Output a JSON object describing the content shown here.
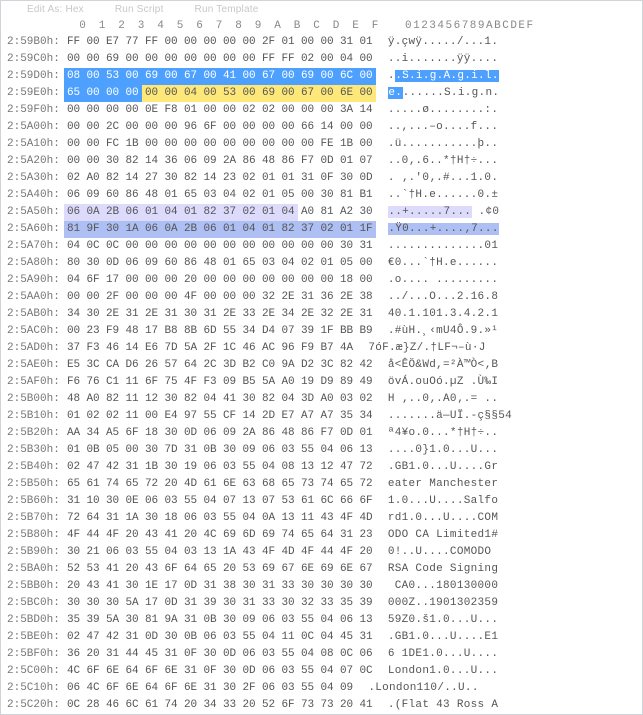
{
  "toolbar": {
    "item1": "Edit As: Hex",
    "item2": "Run Script",
    "item3": "Run Template"
  },
  "header": {
    "groups": [
      "0",
      "1",
      "2",
      "3",
      "4",
      "5",
      "6",
      "7",
      "8",
      "9",
      "A",
      "B",
      "C",
      "D",
      "E",
      "F"
    ],
    "ascii": "0123456789ABCDEF"
  },
  "rows": [
    {
      "addr": "2:59B0h:",
      "hex": [
        {
          "t": "FF 00 E7 77 FF 00 00 00 00 00 2F 01 00 00 31 01",
          "c": ""
        }
      ],
      "asc": [
        {
          "t": "ÿ.çwÿ...../...1.",
          "c": ""
        }
      ]
    },
    {
      "addr": "2:59C0h:",
      "hex": [
        {
          "t": "00 00 69 00 00 00 00 00 00 00 FF FF 02 00 04 00",
          "c": ""
        }
      ],
      "asc": [
        {
          "t": "..i.......ÿÿ....",
          "c": ""
        }
      ]
    },
    {
      "addr": "2:59D0h:",
      "hex": [
        {
          "t": "08 00 53 00 69 00 67 00 41 00 67 00 69 00 6C 00",
          "c": "hl-blue"
        }
      ],
      "asc": [
        {
          "t": ".",
          "c": ""
        },
        {
          "t": ".S.i.g.A.g.i.l.",
          "c": "hl-blue-asc"
        }
      ]
    },
    {
      "addr": "2:59E0h:",
      "hex": [
        {
          "t": "65 00 00 00 ",
          "c": "hl-blue"
        },
        {
          "t": "00 00 04 00 53 00 69 00 67 00 6E 00",
          "c": "hl-yellow"
        }
      ],
      "asc": [
        {
          "t": "e.",
          "c": "hl-blue-asc"
        },
        {
          "t": "......S.i.g.n.",
          "c": ""
        }
      ]
    },
    {
      "addr": "2:59F0h:",
      "hex": [
        {
          "t": "00 00 00 00 0E F8 01 00 00 02 02 00 00 00 3A 14",
          "c": ""
        }
      ],
      "asc": [
        {
          "t": ".....ø........:.",
          "c": ""
        }
      ]
    },
    {
      "addr": "2:5A00h:",
      "hex": [
        {
          "t": "00 00 2C 00 00 00 96 6F 00 00 00 00 66 14 00 00",
          "c": ""
        }
      ],
      "asc": [
        {
          "t": "..,...–o....f...",
          "c": ""
        }
      ]
    },
    {
      "addr": "2:5A10h:",
      "hex": [
        {
          "t": "00 00 FC 1B 00 00 00 00 00 00 00 00 00 FE 1B 00",
          "c": ""
        }
      ],
      "asc": [
        {
          "t": ".ü...........þ..",
          "c": ""
        }
      ]
    },
    {
      "addr": "2:5A20h:",
      "hex": [
        {
          "t": "00 00 30 82 14 36 06 09 2A 86 48 86 F7 0D 01 07",
          "c": ""
        }
      ],
      "asc": [
        {
          "t": "..0‚.6..*†H†÷...",
          "c": ""
        }
      ]
    },
    {
      "addr": "2:5A30h:",
      "hex": [
        {
          "t": "02 A0 82 14 27 30 82 14 23 02 01 01 31 0F 30 0D",
          "c": ""
        }
      ],
      "asc": [
        {
          "t": ". ‚.'0‚.#...1.0.",
          "c": ""
        }
      ]
    },
    {
      "addr": "2:5A40h:",
      "hex": [
        {
          "t": "06 09 60 86 48 01 65 03 04 02 01 05 00 30 81 B1",
          "c": ""
        }
      ],
      "asc": [
        {
          "t": "..`†H.e......0.±",
          "c": ""
        }
      ]
    },
    {
      "addr": "2:5A50h:",
      "hex": [
        {
          "t": "06 0A 2B 06 01 04 01 82 37 02 01 04 ",
          "c": "hl-lav"
        },
        {
          "t": "A0 81 A2 30",
          "c": ""
        }
      ],
      "asc": [
        {
          "t": "..+.....7...",
          "c": "hl-lav-asc"
        },
        {
          "t": " .¢0",
          "c": ""
        }
      ]
    },
    {
      "addr": "2:5A60h:",
      "hex": [
        {
          "t": "81 9F 30 1A 06 0A 2B 06 01 04 01 82 37 02 01 1F",
          "c": "hl-blue2"
        }
      ],
      "asc": [
        {
          "t": ".Ÿ0...+....‚7...",
          "c": "hl-blue2-asc"
        }
      ]
    },
    {
      "addr": "2:5A70h:",
      "hex": [
        {
          "t": "04 0C 0C 00 00 00 00 00 00 00 00 00 00 00 30 31",
          "c": ""
        }
      ],
      "asc": [
        {
          "t": "..............01",
          "c": ""
        }
      ]
    },
    {
      "addr": "2:5A80h:",
      "hex": [
        {
          "t": "80 30 0D 06 09 60 86 48 01 65 03 04 02 01 05 00",
          "c": ""
        }
      ],
      "asc": [
        {
          "t": "€0...`†H.e......",
          "c": ""
        }
      ]
    },
    {
      "addr": "2:5A90h:",
      "hex": [
        {
          "t": "04 6F 17 00 00 00 20 00 00 00 00 00 00 00 18 00",
          "c": ""
        }
      ],
      "asc": [
        {
          "t": ".o.... .........",
          "c": ""
        }
      ]
    },
    {
      "addr": "2:5AA0h:",
      "hex": [
        {
          "t": "00 00 2F 00 00 00 4F 00 00 00 32 2E 31 36 2E 38",
          "c": ""
        }
      ],
      "asc": [
        {
          "t": "../...O...2.16.8",
          "c": ""
        }
      ]
    },
    {
      "addr": "2:5AB0h:",
      "hex": [
        {
          "t": "34 30 2E 31 2E 31 30 31 2E 33 2E 34 2E 32 2E 31",
          "c": ""
        }
      ],
      "asc": [
        {
          "t": "40.1.101.3.4.2.1",
          "c": ""
        }
      ]
    },
    {
      "addr": "2:5AC0h:",
      "hex": [
        {
          "t": "00 23 F9 48 17 B8 8B 6D 55 34 D4 07 39 1F BB B9",
          "c": ""
        }
      ],
      "asc": [
        {
          "t": ".#ùH.¸‹mU4Ô.9.»¹",
          "c": ""
        }
      ]
    },
    {
      "addr": "2:5AD0h:",
      "hex": [
        {
          "t": "37 F3 46 14 E6 7D 5A 2F 1C 46 AC 96 F9 B7 4A",
          "c": ""
        }
      ],
      "asc": [
        {
          "t": "7óF.æ}Z/.†LF¬–ù·J",
          "c": ""
        }
      ]
    },
    {
      "addr": "2:5AE0h:",
      "hex": [
        {
          "t": "E5 3C CA D6 26 57 64 2C 3D B2 C0 9A D2 3C 82 42",
          "c": ""
        }
      ],
      "asc": [
        {
          "t": "å<ÊÖ&Wd,=²À™Ò<‚B",
          "c": ""
        }
      ]
    },
    {
      "addr": "2:5AF0h:",
      "hex": [
        {
          "t": "F6 76 C1 11 6F 75 4F F3 09 B5 5A A0 19 D9 89 49",
          "c": ""
        }
      ],
      "asc": [
        {
          "t": "övÁ.ouOó.µZ .Ù‰I",
          "c": ""
        }
      ]
    },
    {
      "addr": "2:5B00h:",
      "hex": [
        {
          "t": "48 A0 82 11 12 30 82 04 41 30 82 04 3D A0 03 02",
          "c": ""
        }
      ],
      "asc": [
        {
          "t": "H ‚..0‚.A0‚.= ..",
          "c": ""
        }
      ]
    },
    {
      "addr": "2:5B10h:",
      "hex": [
        {
          "t": "01 02 02 11 00 E4 97 55 CF 14 2D E7 A7 A7 35 34",
          "c": ""
        }
      ],
      "asc": [
        {
          "t": ".......ä—UÏ.-ç§§54",
          "c": ""
        }
      ]
    },
    {
      "addr": "2:5B20h:",
      "hex": [
        {
          "t": "AA 34 A5 6F 18 30 0D 06 09 2A 86 48 86 F7 0D 01",
          "c": ""
        }
      ],
      "asc": [
        {
          "t": "ª4¥o.0...*†H†÷..",
          "c": ""
        }
      ]
    },
    {
      "addr": "2:5B30h:",
      "hex": [
        {
          "t": "01 0B 05 00 30 7D 31 0B 30 09 06 03 55 04 06 13",
          "c": ""
        }
      ],
      "asc": [
        {
          "t": "....0}1.0...U...",
          "c": ""
        }
      ]
    },
    {
      "addr": "2:5B40h:",
      "hex": [
        {
          "t": "02 47 42 31 1B 30 19 06 03 55 04 08 13 12 47 72",
          "c": ""
        }
      ],
      "asc": [
        {
          "t": ".GB1.0...U....Gr",
          "c": ""
        }
      ]
    },
    {
      "addr": "2:5B50h:",
      "hex": [
        {
          "t": "65 61 74 65 72 20 4D 61 6E 63 68 65 73 74 65 72",
          "c": ""
        }
      ],
      "asc": [
        {
          "t": "eater Manchester",
          "c": ""
        }
      ]
    },
    {
      "addr": "2:5B60h:",
      "hex": [
        {
          "t": "31 10 30 0E 06 03 55 04 07 13 07 53 61 6C 66 6F",
          "c": ""
        }
      ],
      "asc": [
        {
          "t": "1.0...U....Salfo",
          "c": ""
        }
      ]
    },
    {
      "addr": "2:5B70h:",
      "hex": [
        {
          "t": "72 64 31 1A 30 18 06 03 55 04 0A 13 11 43 4F 4D",
          "c": ""
        }
      ],
      "asc": [
        {
          "t": "rd1.0...U....COM",
          "c": ""
        }
      ]
    },
    {
      "addr": "2:5B80h:",
      "hex": [
        {
          "t": "4F 44 4F 20 43 41 20 4C 69 6D 69 74 65 64 31 23",
          "c": ""
        }
      ],
      "asc": [
        {
          "t": "ODO CA Limited1#",
          "c": ""
        }
      ]
    },
    {
      "addr": "2:5B90h:",
      "hex": [
        {
          "t": "30 21 06 03 55 04 03 13 1A 43 4F 4D 4F 44 4F 20",
          "c": ""
        }
      ],
      "asc": [
        {
          "t": "0!..U....COMODO ",
          "c": ""
        }
      ]
    },
    {
      "addr": "2:5BA0h:",
      "hex": [
        {
          "t": "52 53 41 20 43 6F 64 65 20 53 69 67 6E 69 6E 67",
          "c": ""
        }
      ],
      "asc": [
        {
          "t": "RSA Code Signing",
          "c": ""
        }
      ]
    },
    {
      "addr": "2:5BB0h:",
      "hex": [
        {
          "t": "20 43 41 30 1E 17 0D 31 38 30 31 33 30 30 30 30",
          "c": ""
        }
      ],
      "asc": [
        {
          "t": " CA0...180130000",
          "c": ""
        }
      ]
    },
    {
      "addr": "2:5BC0h:",
      "hex": [
        {
          "t": "30 30 30 5A 17 0D 31 39 30 31 33 30 32 33 35 39",
          "c": ""
        }
      ],
      "asc": [
        {
          "t": "000Z..1901302359",
          "c": ""
        }
      ]
    },
    {
      "addr": "2:5BD0h:",
      "hex": [
        {
          "t": "35 39 5A 30 81 9A 31 0B 30 09 06 03 55 04 06 13",
          "c": ""
        }
      ],
      "asc": [
        {
          "t": "59Z0.š1.0...U...",
          "c": ""
        }
      ]
    },
    {
      "addr": "2:5BE0h:",
      "hex": [
        {
          "t": "02 47 42 31 0D 30 0B 06 03 55 04 11 0C 04 45 31",
          "c": ""
        }
      ],
      "asc": [
        {
          "t": ".GB1.0...U....E1",
          "c": ""
        }
      ]
    },
    {
      "addr": "2:5BF0h:",
      "hex": [
        {
          "t": "36 20 31 44 45 31 0F 30 0D 06 03 55 04 08 0C 06",
          "c": ""
        }
      ],
      "asc": [
        {
          "t": "6 1DE1.0...U....",
          "c": ""
        }
      ]
    },
    {
      "addr": "2:5C00h:",
      "hex": [
        {
          "t": "4C 6F 6E 64 6F 6E 31 0F 30 0D 06 03 55 04 07 0C",
          "c": ""
        }
      ],
      "asc": [
        {
          "t": "London1.0...U...",
          "c": ""
        }
      ]
    },
    {
      "addr": "2:5C10h:",
      "hex": [
        {
          "t": "06 4C 6F 6E 64 6F 6E 31 30 2F 06 03 55 04 09",
          "c": ""
        }
      ],
      "asc": [
        {
          "t": ".London110/..U..",
          "c": ""
        }
      ]
    },
    {
      "addr": "2:5C20h:",
      "hex": [
        {
          "t": "0C 28 46 6C 61 74 20 34 33 20 52 6F 73 73 20 41",
          "c": ""
        }
      ],
      "asc": [
        {
          "t": ".(Flat 43 Ross A",
          "c": ""
        }
      ]
    }
  ]
}
